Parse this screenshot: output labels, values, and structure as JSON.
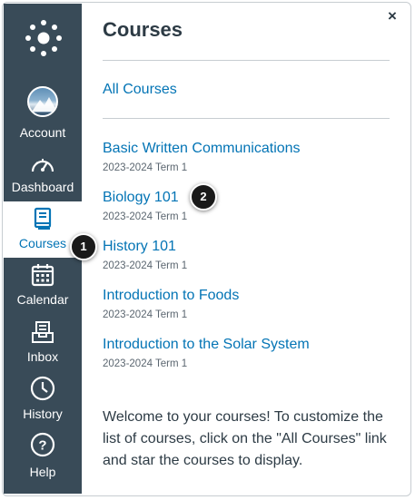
{
  "sidebar": {
    "items": [
      {
        "key": "account",
        "label": "Account",
        "icon": "user-avatar"
      },
      {
        "key": "dashboard",
        "label": "Dashboard",
        "icon": "dashboard-gauge-icon"
      },
      {
        "key": "courses",
        "label": "Courses",
        "icon": "book-icon",
        "active": true
      },
      {
        "key": "calendar",
        "label": "Calendar",
        "icon": "calendar-icon"
      },
      {
        "key": "inbox",
        "label": "Inbox",
        "icon": "inbox-icon"
      },
      {
        "key": "history",
        "label": "History",
        "icon": "clock-icon"
      },
      {
        "key": "help",
        "label": "Help",
        "icon": "question-circle-icon"
      }
    ]
  },
  "tray": {
    "title": "Courses",
    "close_label": "×",
    "all_courses": "All Courses",
    "courses": [
      {
        "name": "Basic Written Communications",
        "term": "2023-2024 Term 1"
      },
      {
        "name": "Biology 101",
        "term": "2023-2024 Term 1"
      },
      {
        "name": "History 101",
        "term": "2023-2024 Term 1"
      },
      {
        "name": "Introduction to Foods",
        "term": "2023-2024 Term 1"
      },
      {
        "name": "Introduction to the Solar System",
        "term": "2023-2024 Term 1"
      }
    ],
    "welcome": "Welcome to your courses! To customize the list of courses, click on the \"All Courses\" link and star the courses to display."
  },
  "callouts": [
    "1",
    "2"
  ],
  "colors": {
    "sidebar": "#394b58",
    "link": "#0374b5",
    "text": "#2d3b45"
  }
}
